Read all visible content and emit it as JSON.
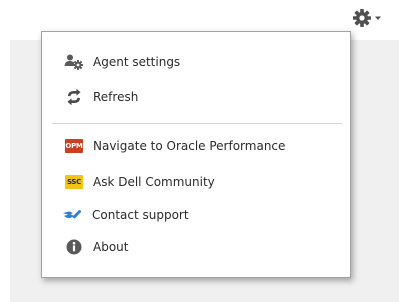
{
  "toolbar": {
    "settings_icon": "gear-icon",
    "dropdown_icon": "caret-down-icon"
  },
  "menu": {
    "items": [
      {
        "label": "Agent settings",
        "icon": "agent-settings-icon"
      },
      {
        "label": "Refresh",
        "icon": "refresh-icon"
      },
      {
        "label": "Navigate to Oracle Performance",
        "icon": "opm-icon",
        "badge": "OPM"
      },
      {
        "label": "Ask Dell Community",
        "icon": "ssc-icon",
        "badge": "SSC"
      },
      {
        "label": "Contact support",
        "icon": "contact-support-icon"
      },
      {
        "label": "About",
        "icon": "info-icon"
      }
    ]
  },
  "colors": {
    "opm_badge": "#c8401c",
    "ssc_badge": "#f0c419",
    "support_icon": "#2f7fd0",
    "refresh_icon": "#4a4a4a"
  }
}
